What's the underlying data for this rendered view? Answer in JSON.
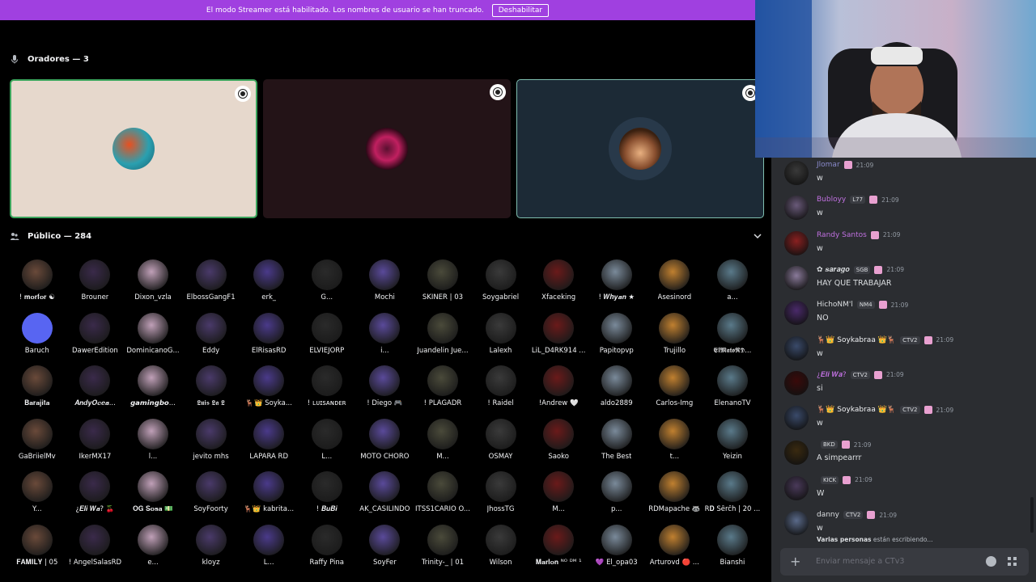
{
  "banner": {
    "text": "El modo Streamer está habilitado. Los nombres de usuario se han truncado.",
    "button": "Deshabilitar"
  },
  "speakers": {
    "header": "Oradores — 3"
  },
  "audience": {
    "header": "Público — 284",
    "members": [
      "! 𝐦𝐨𝐫𝐟𝐨𝐫 ☯",
      "Brouner",
      "Dixon_vzla",
      "ElbossGangF1",
      "erk_",
      "G...",
      "Mochi",
      "SKINER | 03",
      "Soygabriel",
      "Xfaceking",
      "! 𝑾𝒉𝒚𝒂𝒏 ★",
      "Asesinord",
      "a...",
      "Baruch",
      "DawerEdition",
      "DominicanoG...",
      "Eddy",
      "ElRisasRD",
      "ELVIEJORP",
      "i...",
      "Juandelin Jue...",
      "Lalexh",
      "LiL_D4RK914 ...",
      "Papitopvp",
      "Trujillo",
      "𝕰𝖑𝕸𝖆𝖙𝖔𝕽𝕯...",
      "𝐁𝐚𝐫𝐚𝐣𝐢𝐭𝐚",
      "𝑨𝒏𝒅𝒚𝑶𝒄𝒆𝒂...",
      "𝙜𝙖𝙢𝙞𝙣𝙜𝙗𝙤...",
      "𝕷𝖚𝖎𝖘 𝕷𝖆 𝕷",
      "🦌👑 Soyka...",
      "! ʟᴜɪꜱᴀɴᴅᴇʀ",
      "! Diego 🎮",
      "! PLAGADR",
      "! Raidel",
      "!Andrew 🤍",
      "aldo2889",
      "Carlos-Img",
      "ElenanoTV",
      "GaBriielMv",
      "IkerMX17",
      "l...",
      "jevito mhs",
      "LAPARA RD",
      "L...",
      "MOTO CHORO",
      "M...",
      "OSMAY",
      "Saoko",
      "The Best",
      "t...",
      "Yeizin",
      "Y...",
      "¿𝑬𝒍𝒊 𝑾𝒂? 🍒",
      "𝐎𝐆 𝐒𝐨𝐬𝐚 💵",
      "SoyFoorty",
      "🦌👑 kabrita...",
      "! 𝑩𝒖𝑩𝒊",
      "AK_CASILINDO",
      "ITSS1CARIO O...",
      "JhossTG",
      "M...",
      "p...",
      "RDMapache 🦝",
      "R𝐃 Šêrčĥ | 20 ...",
      "𝐅𝐀𝐌𝐈𝐋𝐘 | 05",
      "! AngelSalasRD",
      "e...",
      "kloyz",
      "L...",
      "Raffy Pina",
      "SoyFer",
      "Trinity-_ | 01",
      "Wilson",
      "𝐌𝐚𝐫𝐥𝐨𝐧 ᴺᴼ ᴰᴹ ¹",
      "💜 El_opa03",
      "Arturovd 🔴 ...",
      "Bianshi"
    ]
  },
  "chat": {
    "messages": [
      {
        "user": "Jlomar",
        "tags": [],
        "time": "21:09",
        "text": "w"
      },
      {
        "user": "Bubloyy",
        "tags": [
          "L77"
        ],
        "time": "21:09",
        "text": "w"
      },
      {
        "user": "Randy Santos",
        "tags": [],
        "time": "21:09",
        "text": "w"
      },
      {
        "user": "✿ 𝒔𝒂𝒓𝒂𝒈𝒐",
        "tags": [
          "SGB"
        ],
        "time": "21:09",
        "text": "HAY QUE TRABAJAR"
      },
      {
        "user": "HichoNM'l",
        "tags": [
          "NM4"
        ],
        "time": "21:09",
        "text": "NO"
      },
      {
        "user": "🦌👑 Soykabraa 👑🦌",
        "tags": [
          "CTV2"
        ],
        "time": "21:09",
        "text": "w"
      },
      {
        "user": "¿𝑬𝒍𝒊 𝑾𝒂?",
        "tags": [
          "CTV2"
        ],
        "time": "21:09",
        "text": "si"
      },
      {
        "user": "🦌👑 Soykabraa 👑🦌",
        "tags": [
          "CTV2"
        ],
        "time": "21:09",
        "text": "w"
      },
      {
        "user": "",
        "tags": [
          "BKD"
        ],
        "time": "21:09",
        "text": "A simpearrr"
      },
      {
        "user": "",
        "tags": [
          "KICK"
        ],
        "time": "21:09",
        "text": "W"
      },
      {
        "user": "danny",
        "tags": [
          "CTV2"
        ],
        "time": "21:09",
        "text": "w"
      }
    ],
    "typing_bold": "Varias personas",
    "typing_rest": " están escribiendo...",
    "placeholder": "Enviar mensaje a CTv3"
  }
}
